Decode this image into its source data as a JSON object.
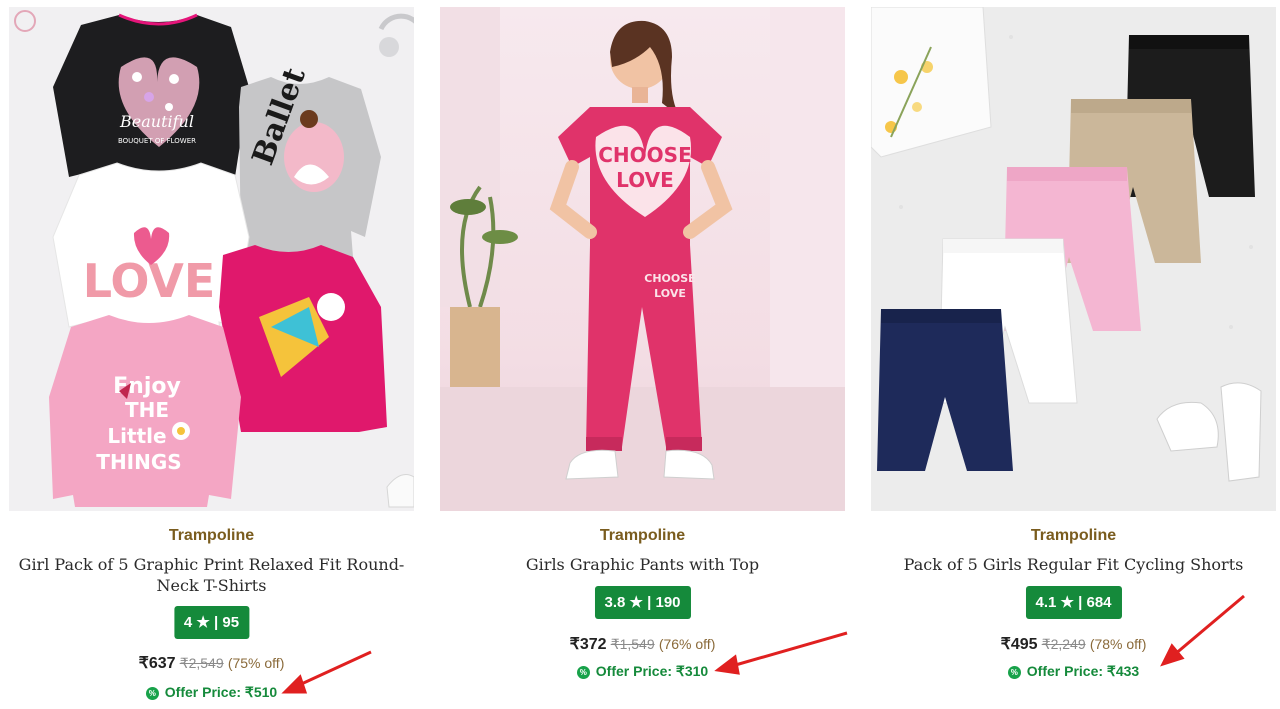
{
  "products": [
    {
      "brand": "Trampoline",
      "title": "Girl Pack of 5 Graphic Print Relaxed Fit Round-Neck T-Shirts",
      "rating_badge": "4 ★ | 95",
      "price": "₹637",
      "mrp": "₹2,549",
      "discount": "(75% off)",
      "offer_price": "Offer Price: ₹510",
      "offer_icon": "%",
      "image_text": {
        "shirt1_line1": "Beautiful",
        "shirt1_line2": "BOUQUET OF FLOWER",
        "shirt2": "Ballet",
        "shirt3": "LOVE",
        "shirt5_line1": "Enjoy",
        "shirt5_line2": "THE",
        "shirt5_line3": "Little",
        "shirt5_line4": "THINGS"
      }
    },
    {
      "brand": "Trampoline",
      "title": "Girls Graphic Pants with Top",
      "rating_badge": "3.8 ★ | 190",
      "price": "₹372",
      "mrp": "₹1,549",
      "discount": "(76% off)",
      "offer_price": "Offer Price: ₹310",
      "offer_icon": "%",
      "image_text": {
        "top_line1": "CHOOSE",
        "top_line2": "LOVE",
        "pant_line1": "CHOOSE",
        "pant_line2": "LOVE"
      }
    },
    {
      "brand": "Trampoline",
      "title": "Pack of 5 Girls Regular Fit Cycling Shorts",
      "rating_badge": "4.1 ★ | 684",
      "price": "₹495",
      "mrp": "₹2,249",
      "discount": "(78% off)",
      "offer_price": "Offer Price: ₹433",
      "offer_icon": "%"
    }
  ],
  "colors": {
    "brand": "#7a5c1e",
    "rating_bg": "#158a3b",
    "offer": "#158a3b",
    "annotation_arrow": "#e02020"
  }
}
